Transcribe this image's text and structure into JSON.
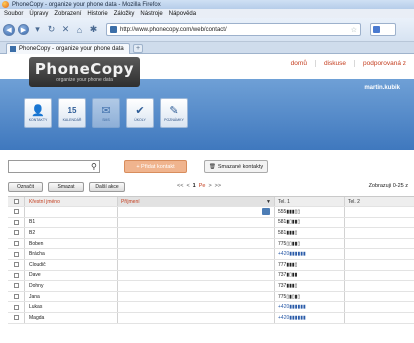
{
  "browser": {
    "window_title": "PhoneCopy - organize your phone data - Mozilla Firefox",
    "menu": [
      "Soubor",
      "Úpravy",
      "Zobrazení",
      "Historie",
      "Záložky",
      "Nástroje",
      "Nápověda"
    ],
    "url": "http://www.phonecopy.com/web/contact/",
    "tab_title": "PhoneCopy - organize your phone data",
    "new_tab": "+"
  },
  "app": {
    "logo_title": "PhoneCopy",
    "logo_subtitle": "organize your phone data",
    "top_links": [
      "domů",
      "diskuse",
      "podporovaná z"
    ],
    "user": "martin.kubik",
    "modules": [
      {
        "label": "KONTAKTY",
        "icon": "contacts-icon",
        "glyph": "👤",
        "disabled": false
      },
      {
        "label": "KALENDÁŘ",
        "icon": "calendar-icon",
        "glyph": "15",
        "disabled": false
      },
      {
        "label": "SMS",
        "icon": "sms-icon",
        "glyph": "✉",
        "disabled": true
      },
      {
        "label": "ÚKOLY",
        "icon": "tasks-icon",
        "glyph": "✔",
        "disabled": false
      },
      {
        "label": "POZNÁMKY",
        "icon": "notes-icon",
        "glyph": "✎",
        "disabled": false
      }
    ]
  },
  "toolbar": {
    "search_value": "",
    "add_label": "+ Přidat kontakt",
    "deleted_label": "Smazané kontakty"
  },
  "list_toolbar": {
    "buttons": [
      "Označit",
      "Smazat",
      "Další akce"
    ],
    "pager": {
      "first": "<<",
      "prev": "<",
      "current": "1",
      "of": "Pe",
      "next": ">",
      "last": ">>"
    },
    "count": "Zobrazuji 0-25 z"
  },
  "table": {
    "headers": {
      "first": "Křestní jméno",
      "last": "Příjmení",
      "tel1": "Tel. 1",
      "tel2": "Tel. 2"
    },
    "rows": [
      {
        "first": "",
        "tel1": "555▮▮▮▯▯",
        "tel1_link": false,
        "vcard": true
      },
      {
        "first": "B1",
        "tel1": "581▮▯▮▮▯",
        "tel1_link": false,
        "vcard": false
      },
      {
        "first": "B2",
        "tel1": "581▮▮▮▯",
        "tel1_link": false,
        "vcard": false
      },
      {
        "first": "Boben",
        "tel1": "775▯▯▮▮▯",
        "tel1_link": false,
        "vcard": false
      },
      {
        "first": "Brácha",
        "tel1": "+420▮▮▮▮▮▮",
        "tel1_link": true,
        "vcard": false
      },
      {
        "first": "Cloudič",
        "tel1": "777▮▮▮▯",
        "tel1_link": false,
        "vcard": false
      },
      {
        "first": "Dave",
        "tel1": "737▮▯▮▮",
        "tel1_link": false,
        "vcard": false
      },
      {
        "first": "Dohny",
        "tel1": "737▮▮▮▯",
        "tel1_link": false,
        "vcard": false
      },
      {
        "first": "Jana",
        "tel1": "775▯▮▯▮▯",
        "tel1_link": false,
        "vcard": false
      },
      {
        "first": "Lukas",
        "tel1": "+420▮▮▮▮▮▮",
        "tel1_link": true,
        "vcard": false
      },
      {
        "first": "Magda",
        "tel1": "+420▮▮▮▮▮▮",
        "tel1_link": true,
        "vcard": false
      }
    ]
  }
}
